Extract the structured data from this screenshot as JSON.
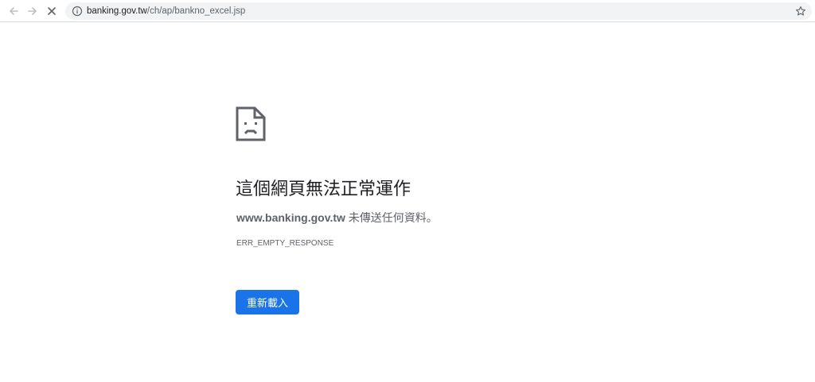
{
  "colors": {
    "accent": "#1a73e8",
    "title_text": "#202124",
    "secondary_text": "#5f6368",
    "omnibox_bg": "#f1f3f4"
  },
  "toolbar": {
    "back_icon": "arrow-left-icon",
    "forward_icon": "arrow-right-icon",
    "stop_icon": "close-icon",
    "omnibox": {
      "info_icon": "info-icon",
      "url_host": "banking.gov.tw",
      "url_path": "/ch/ap/bankno_excel.jsp",
      "bookmark_icon": "star-icon"
    }
  },
  "error_page": {
    "icon": "sad-page-icon",
    "title": "這個網頁無法正常運作",
    "description_host": "www.banking.gov.tw",
    "description_text": " 未傳送任何資料。",
    "error_code": "ERR_EMPTY_RESPONSE",
    "reload_label": "重新載入"
  }
}
